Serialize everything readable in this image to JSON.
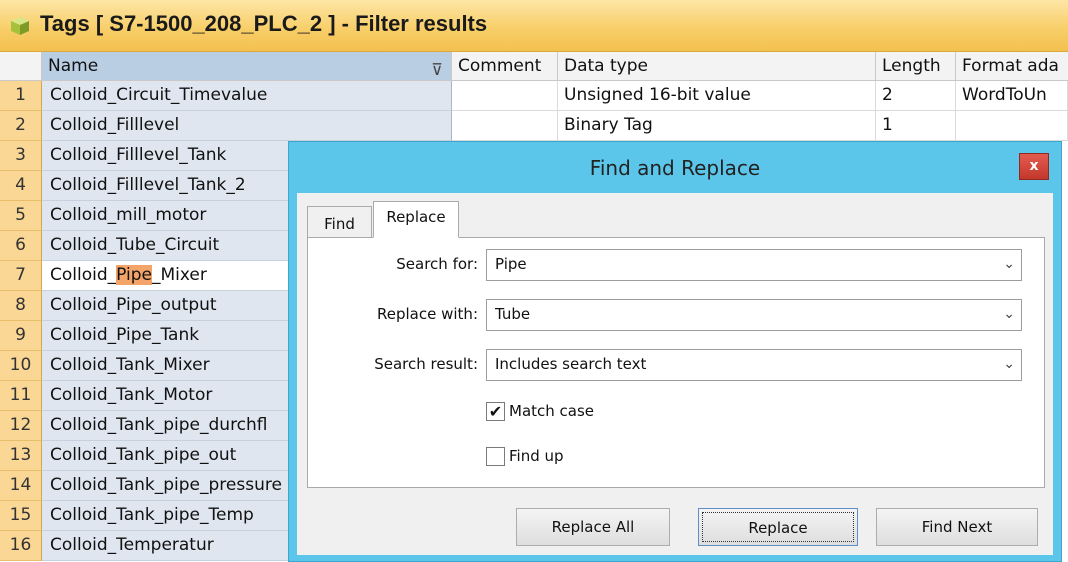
{
  "window": {
    "title": "Tags [ S7-1500_208_PLC_2 ] - Filter results"
  },
  "table": {
    "headers": {
      "name": "Name",
      "comment": "Comment",
      "datatype": "Data type",
      "length": "Length",
      "format": "Format ada"
    },
    "rows": [
      {
        "num": "1",
        "name": "Colloid_Circuit_Timevalue",
        "datatype": "Unsigned 16-bit value",
        "length": "2",
        "format": "WordToUn"
      },
      {
        "num": "2",
        "name": "Colloid_Filllevel",
        "datatype": "Binary Tag",
        "length": "1",
        "format": ""
      },
      {
        "num": "3",
        "name": "Colloid_Filllevel_Tank"
      },
      {
        "num": "4",
        "name": "Colloid_Filllevel_Tank_2"
      },
      {
        "num": "5",
        "name": "Colloid_mill_motor"
      },
      {
        "num": "6",
        "name": "Colloid_Tube_Circuit"
      },
      {
        "num": "7",
        "name_pre": "Colloid_",
        "name_hl": "Pipe",
        "name_post": "_Mixer"
      },
      {
        "num": "8",
        "name": "Colloid_Pipe_output"
      },
      {
        "num": "9",
        "name": "Colloid_Pipe_Tank"
      },
      {
        "num": "10",
        "name": "Colloid_Tank_Mixer"
      },
      {
        "num": "11",
        "name": "Colloid_Tank_Motor"
      },
      {
        "num": "12",
        "name": "Colloid_Tank_pipe_durchfl"
      },
      {
        "num": "13",
        "name": "Colloid_Tank_pipe_out"
      },
      {
        "num": "14",
        "name": "Colloid_Tank_pipe_pressure"
      },
      {
        "num": "15",
        "name": "Colloid_Tank_pipe_Temp"
      },
      {
        "num": "16",
        "name": "Colloid_Temperatur"
      }
    ]
  },
  "dialog": {
    "title": "Find and Replace",
    "close": "x",
    "tabs": {
      "find": "Find",
      "replace": "Replace"
    },
    "search_for": {
      "label": "Search for:",
      "value": "Pipe"
    },
    "replace_with": {
      "label": "Replace with:",
      "value": "Tube"
    },
    "search_result": {
      "label": "Search result:",
      "value": "Includes search text"
    },
    "match_case": {
      "label": "Match case",
      "checked": true
    },
    "find_up": {
      "label": "Find up",
      "checked": false
    },
    "buttons": {
      "replace_all": "Replace All",
      "replace": "Replace",
      "find_next": "Find Next"
    }
  },
  "colors": {
    "title_bar": "#f8cf6a",
    "row_number": "#fad795",
    "name_column": "#dfe6f0",
    "highlight": "#f4a468",
    "dialog_frame": "#5bc6ea"
  }
}
